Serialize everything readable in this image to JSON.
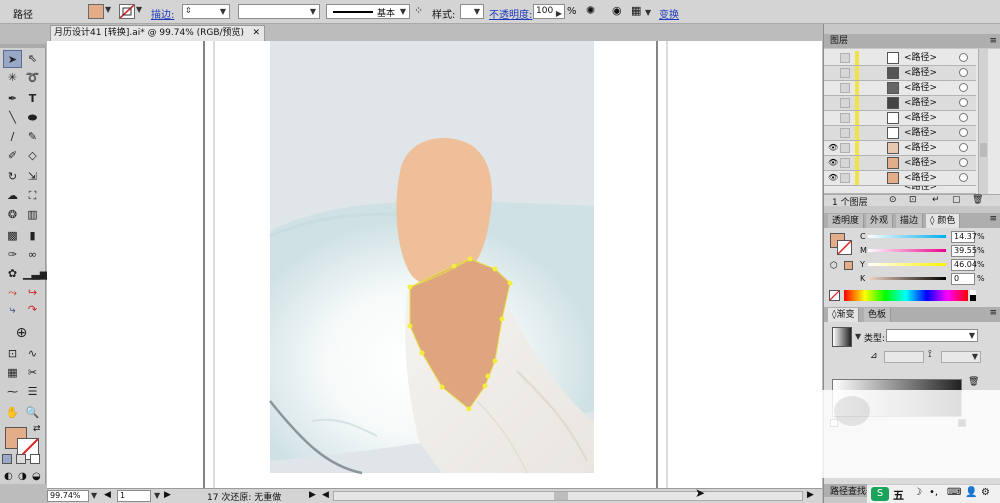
{
  "control_bar": {
    "object_type": "路径",
    "stroke_label": "描边:",
    "stroke_style": "基本",
    "style_label": "样式:",
    "opacity_label": "不透明度:",
    "opacity_value": "100",
    "percent": "%",
    "transform_link": "变换",
    "fill_color": "#e3ad8a"
  },
  "document": {
    "tab_title": "月历设计41 [转换].ai* @ 99.74% (RGB/预览)",
    "close_glyph": "✕"
  },
  "status": {
    "zoom": "99.74%",
    "page": "1",
    "undo_text": "17 次还原: 无重做"
  },
  "layers_panel": {
    "title": "图层",
    "rows": [
      {
        "name": "<路径>",
        "thumb": "#ffffff",
        "eye": false
      },
      {
        "name": "<路径>",
        "thumb": "#555555",
        "eye": false
      },
      {
        "name": "<路径>",
        "thumb": "#666666",
        "eye": false
      },
      {
        "name": "<路径>",
        "thumb": "#444444",
        "eye": false
      },
      {
        "name": "<路径>",
        "thumb": "#ffffff",
        "eye": false
      },
      {
        "name": "<路径>",
        "thumb": "#ffffff",
        "eye": false
      },
      {
        "name": "<路径>",
        "thumb": "#e8c8b0",
        "eye": true
      },
      {
        "name": "<路径>",
        "thumb": "#e3ad8a",
        "eye": true
      },
      {
        "name": "<路径>",
        "thumb": "#e3ad8a",
        "eye": true
      }
    ],
    "footer": "1 个图层",
    "cut_row_name": "<路径>"
  },
  "color_panel": {
    "tabs": [
      "透明度",
      "外观",
      "描边",
      "颜色"
    ],
    "active_tab": "颜色",
    "c_label": "C",
    "c_value": "14.37",
    "m_label": "M",
    "m_value": "39.55",
    "y_label": "Y",
    "y_value": "46.04",
    "k_label": "K",
    "k_value": "0",
    "pct": "%",
    "fill_color": "#e3ad8a"
  },
  "gradient_panel": {
    "tabs": [
      "渐变",
      "色板"
    ],
    "active_tab": "渐变",
    "type_label": "类型:"
  },
  "bottom_panel": {
    "title": "路径查找器"
  },
  "taskbar": {
    "ime_char": "五"
  },
  "colors": {
    "skin": "#efbf99",
    "skin_dark": "#dea57f",
    "bg_blue": "#dfe5e8",
    "anchor": "#f3ee3c"
  }
}
